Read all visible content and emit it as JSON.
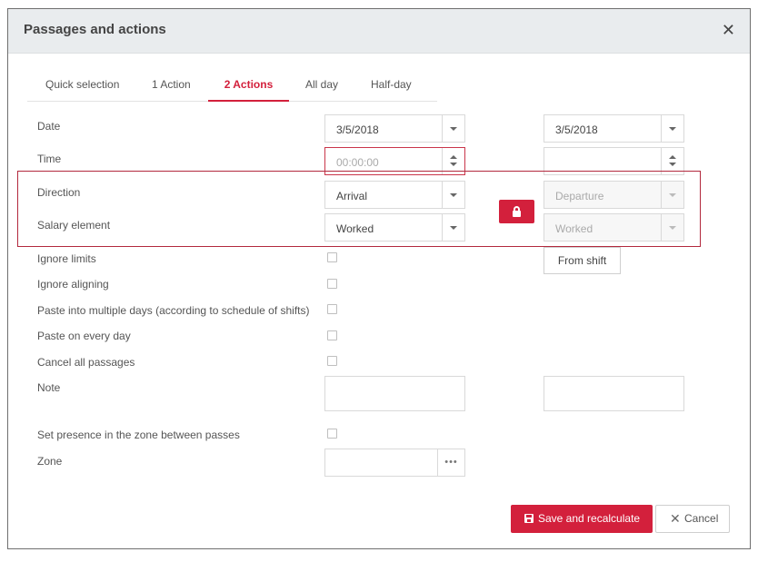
{
  "dialog": {
    "title": "Passages and actions",
    "close_glyph": "✕"
  },
  "tabs": [
    {
      "label": "Quick selection",
      "active": false
    },
    {
      "label": "1 Action",
      "active": false
    },
    {
      "label": "2 Actions",
      "active": true
    },
    {
      "label": "All day",
      "active": false
    },
    {
      "label": "Half-day",
      "active": false
    }
  ],
  "form": {
    "date": {
      "label": "Date",
      "value_left": "3/5/2018",
      "value_right": "3/5/2018"
    },
    "time": {
      "label": "Time",
      "placeholder_left": "00:00:00",
      "value_right": ""
    },
    "direction": {
      "label": "Direction",
      "value_left": "Arrival",
      "value_right": "Departure"
    },
    "salary_element": {
      "label": "Salary element",
      "value_left": "Worked",
      "value_right": "Worked"
    },
    "ignore_limits": {
      "label": "Ignore limits",
      "checked": false
    },
    "ignore_aligning": {
      "label": "Ignore aligning",
      "checked": false
    },
    "paste_multiple": {
      "label": "Paste into multiple days (according to schedule of shifts)",
      "checked": false
    },
    "paste_every_day": {
      "label": "Paste on every day",
      "checked": false
    },
    "cancel_all": {
      "label": "Cancel all passages",
      "checked": false
    },
    "note": {
      "label": "Note",
      "value_left": "",
      "value_right": ""
    },
    "set_presence": {
      "label": "Set presence in the zone between passes",
      "checked": false
    },
    "zone": {
      "label": "Zone",
      "value": "",
      "browse_glyph": "•••"
    },
    "from_shift_label": "From shift"
  },
  "footer": {
    "save_label": "Save and recalculate",
    "cancel_label": "Cancel",
    "cancel_glyph": "✕"
  },
  "colors": {
    "accent": "#d3203c",
    "highlight_border": "#b2283d",
    "header_bg": "#e9ecee"
  },
  "icons": [
    "close-icon",
    "chevron-down-icon",
    "spin-arrows-icon",
    "lock-icon",
    "ellipsis-icon",
    "save-icon"
  ]
}
